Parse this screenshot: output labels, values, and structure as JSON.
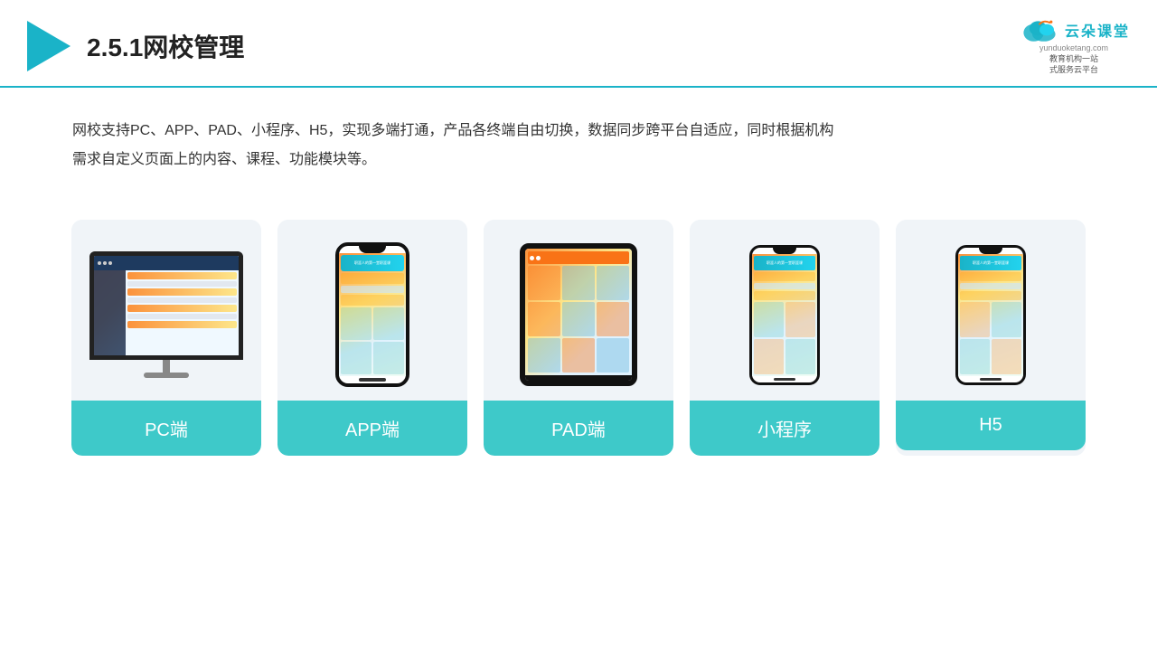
{
  "header": {
    "title": "2.5.1网校管理",
    "brand": {
      "name": "云朵课堂",
      "url": "yunduoketang.com",
      "sub": "教育机构一站\n式服务云平台"
    }
  },
  "description": {
    "text": "网校支持PC、APP、PAD、小程序、H5，实现多端打通，产品各终端自由切换，数据同步跨平台自适应，同时根据机构需求自定义页面上的内容、课程、功能模块等。"
  },
  "cards": [
    {
      "id": "pc",
      "label": "PC端"
    },
    {
      "id": "app",
      "label": "APP端"
    },
    {
      "id": "pad",
      "label": "PAD端"
    },
    {
      "id": "miniprogram",
      "label": "小程序"
    },
    {
      "id": "h5",
      "label": "H5"
    }
  ],
  "colors": {
    "accent": "#1ab3c8",
    "cardBg": "#f0f4f8",
    "labelBg": "#3ec9c9",
    "labelText": "#ffffff"
  }
}
